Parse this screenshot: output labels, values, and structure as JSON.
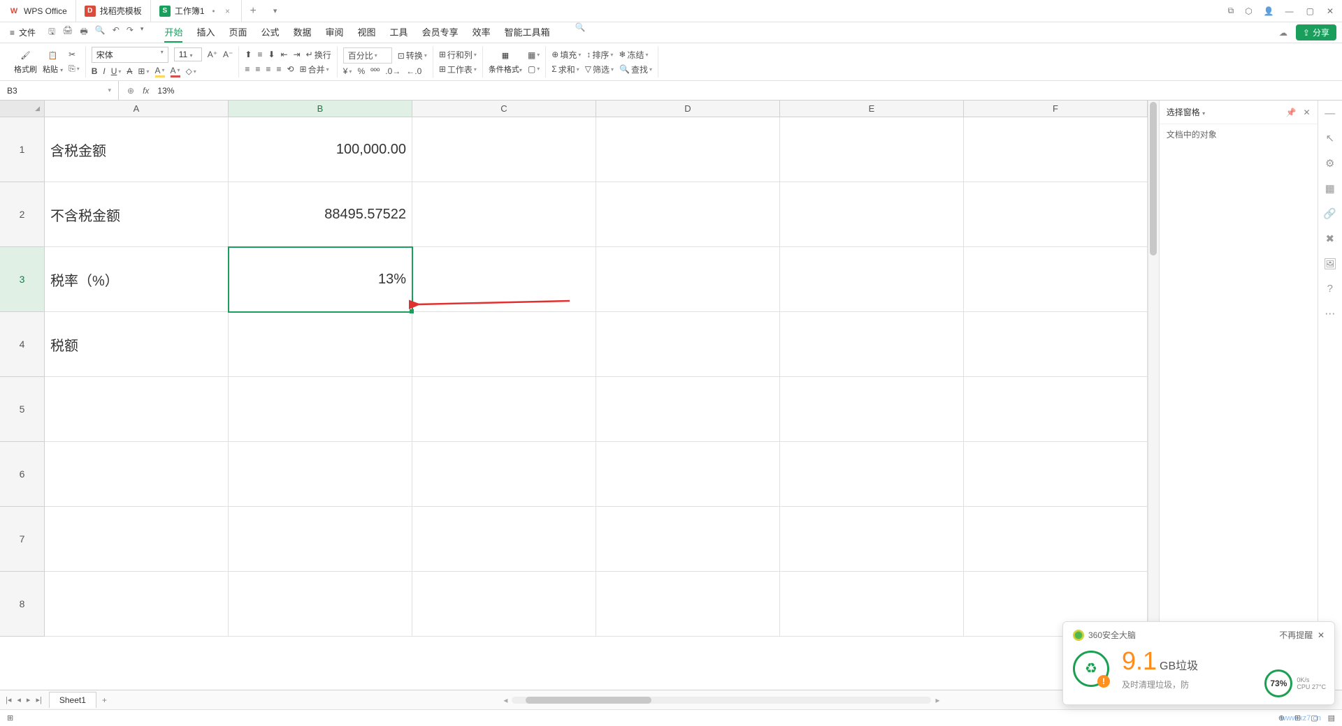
{
  "titlebar": {
    "app": "WPS Office",
    "tab1": "找稻壳模板",
    "tab2": "工作簿1"
  },
  "menus": {
    "file": "文件",
    "tabs": [
      "开始",
      "插入",
      "页面",
      "公式",
      "数据",
      "审阅",
      "视图",
      "工具",
      "会员专享",
      "效率",
      "智能工具箱"
    ],
    "share": "分享"
  },
  "ribbon": {
    "format_brush": "格式刷",
    "paste": "粘贴",
    "font": "宋体",
    "size": "11",
    "percent_fmt": "百分比",
    "convert": "转换",
    "rowcol": "行和列",
    "worksheet": "工作表",
    "cond_fmt": "条件格式",
    "fill": "填充",
    "sort": "排序",
    "freeze": "冻结",
    "sum": "求和",
    "filter": "筛选",
    "find": "查找",
    "wrap": "换行",
    "merge": "合并"
  },
  "formula": {
    "cell_ref": "B3",
    "value": "13%"
  },
  "columns": [
    "A",
    "B",
    "C",
    "D",
    "E",
    "F"
  ],
  "rows": [
    "1",
    "2",
    "3",
    "4",
    "5",
    "6",
    "7",
    "8"
  ],
  "cells": {
    "A1": "含税金额",
    "B1": "100,000.00",
    "A2": "不含税金额",
    "B2": "88495.57522",
    "A3": "税率（%）",
    "B3": "13%",
    "A4": "税额"
  },
  "sidepanel": {
    "title": "选择窗格",
    "sub": "文档中的对象"
  },
  "sheets": {
    "s1": "Sheet1"
  },
  "popup": {
    "title": "360安全大脑",
    "dismiss": "不再提醒",
    "num": "9.1",
    "unit": "GB垃圾",
    "sub": "及时清理垃圾，防",
    "cpu_pct": "73%",
    "net": "0K/s",
    "cpu": "CPU 27°C"
  },
  "watermark": "www.xz7.cn"
}
